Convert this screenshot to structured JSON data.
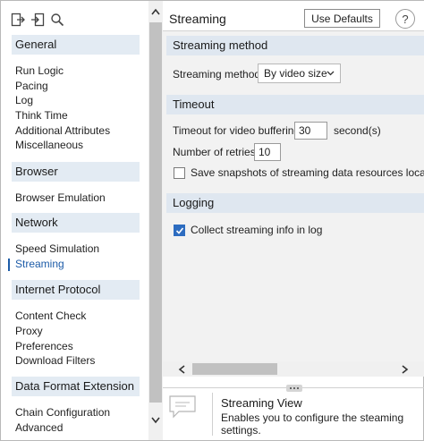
{
  "sidebar": {
    "toolbar": {
      "icons": [
        "export-icon",
        "import-icon",
        "search-icon"
      ]
    },
    "groups": [
      {
        "header": "General",
        "items": [
          "Run Logic",
          "Pacing",
          "Log",
          "Think Time",
          "Additional Attributes",
          "Miscellaneous"
        ]
      },
      {
        "header": "Browser",
        "items": [
          "Browser Emulation"
        ]
      },
      {
        "header": "Network",
        "items": [
          "Speed Simulation",
          "Streaming"
        ]
      },
      {
        "header": "Internet Protocol",
        "items": [
          "Content Check",
          "Proxy",
          "Preferences",
          "Download Filters"
        ]
      },
      {
        "header": "Data Format Extension",
        "items": [
          "Chain Configuration",
          "Advanced"
        ]
      }
    ],
    "selected_item": "Streaming"
  },
  "header": {
    "title": "Streaming",
    "use_defaults_label": "Use Defaults",
    "help_label": "?"
  },
  "sections": {
    "method": {
      "title": "Streaming method",
      "field_label": "Streaming method",
      "selected_value": "By video size"
    },
    "timeout": {
      "title": "Timeout",
      "buffering_label": "Timeout for video buffering",
      "buffering_value": "30",
      "buffering_unit": "second(s)",
      "retries_label": "Number of retries",
      "retries_value": "10",
      "snapshots_label": "Save snapshots of streaming data resources locally",
      "snapshots_checked": false
    },
    "logging": {
      "title": "Logging",
      "collect_label": "Collect streaming info in log",
      "collect_checked": true
    }
  },
  "info_pane": {
    "title": "Streaming View",
    "description": "Enables you to configure the steaming settings."
  },
  "colors": {
    "accent": "#1d5ca8",
    "section_header_bg": "#dfe7f0",
    "panel_bg": "#f2f2f2",
    "checkbox_checked": "#2d6cc0"
  }
}
